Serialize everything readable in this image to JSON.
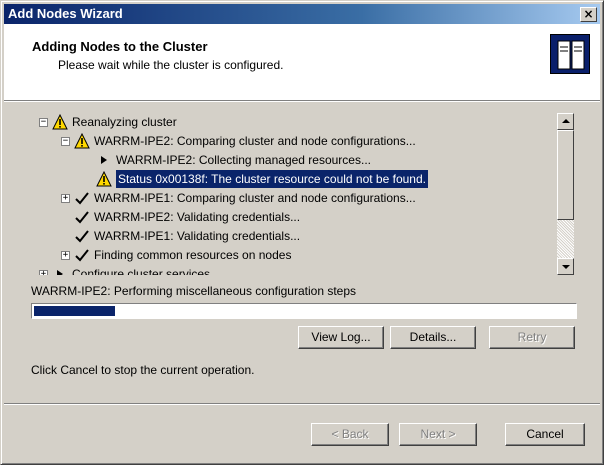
{
  "window": {
    "title": "Add Nodes Wizard"
  },
  "header": {
    "title": "Adding Nodes to the Cluster",
    "subtitle": "Please wait while the cluster is configured."
  },
  "tree": {
    "items": [
      {
        "label": "Reanalyzing cluster",
        "icon": "warning-icon",
        "expander": "−"
      },
      {
        "label": "WARRM-IPE2: Comparing cluster and node configurations...",
        "icon": "warning-icon",
        "expander": "−"
      },
      {
        "label": "WARRM-IPE2: Collecting managed resources...",
        "icon": "play-arrow-icon"
      },
      {
        "label": "Status 0x00138f: The cluster resource could not be found.",
        "icon": "warning-icon",
        "selected": true
      },
      {
        "label": "WARRM-IPE1: Comparing cluster and node configurations...",
        "icon": "checkmark-icon",
        "expander": "+"
      },
      {
        "label": "WARRM-IPE2: Validating credentials...",
        "icon": "checkmark-icon"
      },
      {
        "label": "WARRM-IPE1: Validating credentials...",
        "icon": "checkmark-icon"
      },
      {
        "label": "Finding common resources on nodes",
        "icon": "checkmark-icon",
        "expander": "+"
      },
      {
        "label": "Configure cluster services",
        "icon": "play-arrow-icon",
        "expander": "+"
      }
    ]
  },
  "progress": {
    "status": "WARRM-IPE2: Performing miscellaneous configuration steps",
    "fraction": 0.15
  },
  "buttons": {
    "view_log": "View Log...",
    "details": "Details...",
    "retry": "Retry",
    "back": "< Back",
    "next": "Next >",
    "cancel": "Cancel"
  },
  "note": "Click Cancel to stop the current operation.",
  "colors": {
    "title_bar": "#0a246a",
    "selection": "#0a246a",
    "progress_fill": "#0a246a",
    "face": "#d4d0c8"
  }
}
